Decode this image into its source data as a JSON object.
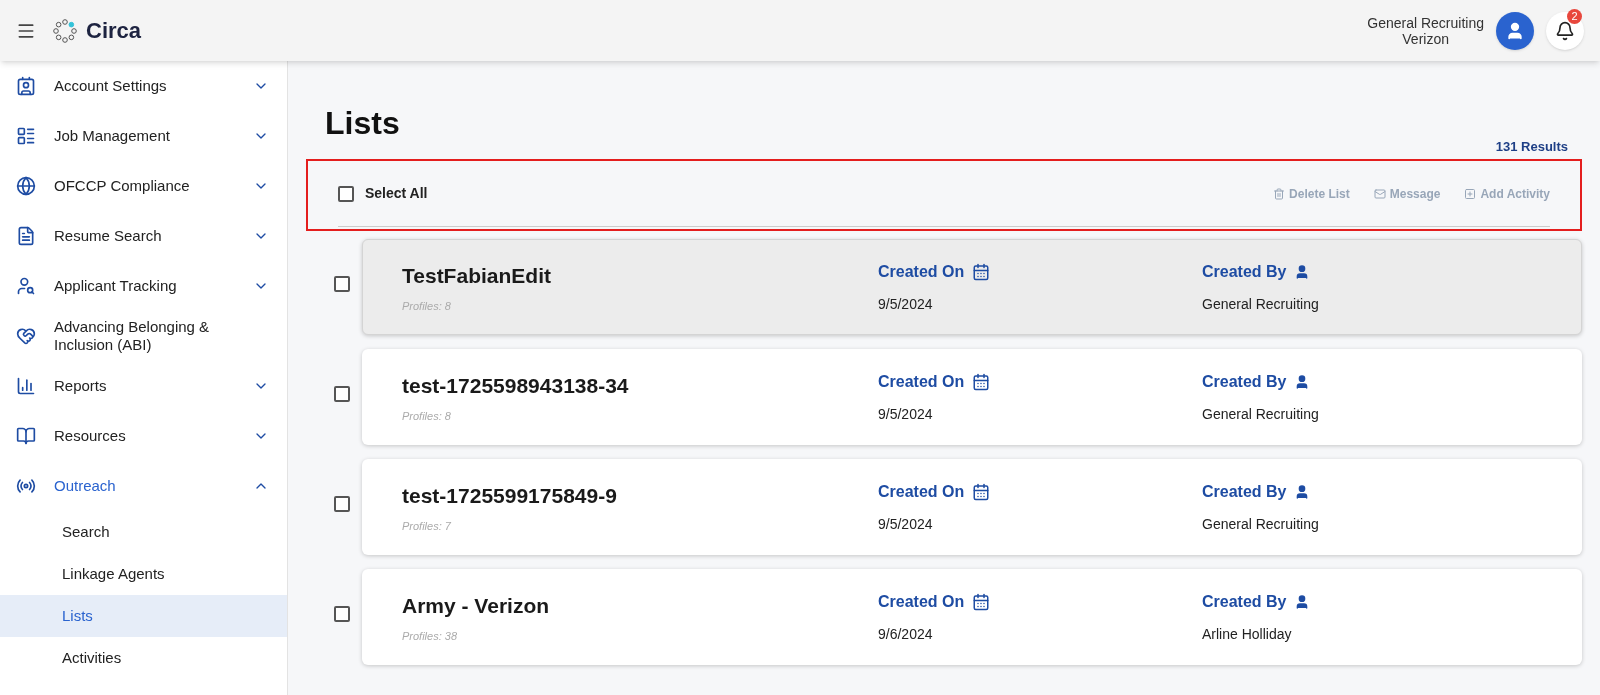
{
  "header": {
    "logo": "Circa",
    "user_name": "General Recruiting",
    "user_org": "Verizon",
    "notification_count": "2"
  },
  "sidebar": {
    "items": [
      {
        "label": "Account Settings",
        "has_children": true,
        "expanded": false,
        "selected": false
      },
      {
        "label": "Job Management",
        "has_children": true,
        "expanded": false,
        "selected": false
      },
      {
        "label": "OFCCP Compliance",
        "has_children": true,
        "expanded": false,
        "selected": false
      },
      {
        "label": "Resume Search",
        "has_children": true,
        "expanded": false,
        "selected": false
      },
      {
        "label": "Applicant Tracking",
        "has_children": true,
        "expanded": false,
        "selected": false
      },
      {
        "label": "Advancing Belonging & Inclusion (ABI)",
        "has_children": false,
        "selected": false
      },
      {
        "label": "Reports",
        "has_children": true,
        "expanded": false,
        "selected": false
      },
      {
        "label": "Resources",
        "has_children": true,
        "expanded": false,
        "selected": false
      },
      {
        "label": "Outreach",
        "has_children": true,
        "expanded": true,
        "selected": true,
        "children": [
          {
            "label": "Search",
            "selected": false
          },
          {
            "label": "Linkage Agents",
            "selected": false
          },
          {
            "label": "Lists",
            "selected": true
          },
          {
            "label": "Activities",
            "selected": false
          }
        ]
      }
    ]
  },
  "page": {
    "title": "Lists",
    "results": "131 Results"
  },
  "toolbar": {
    "select_all": {
      "label": "Select All",
      "checked": false
    },
    "actions": [
      {
        "label": "Delete List",
        "disabled": true
      },
      {
        "label": "Message",
        "disabled": true
      },
      {
        "label": "Add Activity",
        "disabled": true
      }
    ],
    "highlighted": true
  },
  "lists": [
    {
      "name": "TestFabianEdit",
      "profiles": "Profiles: 8",
      "created_on_label": "Created On",
      "created_on": "9/5/2024",
      "created_by_label": "Created By",
      "created_by": "General Recruiting",
      "checked": false,
      "hovered": true
    },
    {
      "name": "test-1725598943138-34",
      "profiles": "Profiles: 8",
      "created_on_label": "Created On",
      "created_on": "9/5/2024",
      "created_by_label": "Created By",
      "created_by": "General Recruiting",
      "checked": false,
      "hovered": false
    },
    {
      "name": "test-1725599175849-9",
      "profiles": "Profiles: 7",
      "created_on_label": "Created On",
      "created_on": "9/5/2024",
      "created_by_label": "Created By",
      "created_by": "General Recruiting",
      "checked": false,
      "hovered": false
    },
    {
      "name": "Army - Verizon",
      "profiles": "Profiles: 38",
      "created_on_label": "Created On",
      "created_on": "9/6/2024",
      "created_by_label": "Created By",
      "created_by": "Arline Holliday",
      "checked": false,
      "hovered": false
    }
  ]
}
